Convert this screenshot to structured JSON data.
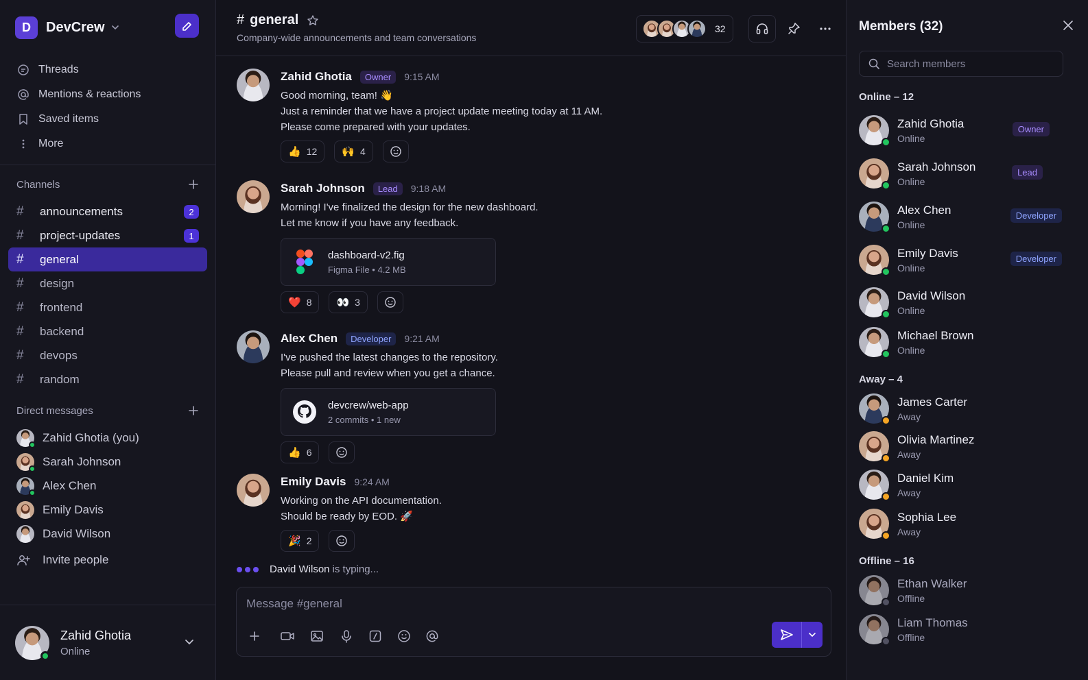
{
  "workspace": {
    "name": "DevCrew",
    "logo_letter": "D"
  },
  "nav": [
    {
      "label": "Threads",
      "icon": "threads-icon"
    },
    {
      "label": "Mentions & reactions",
      "icon": "at-icon"
    },
    {
      "label": "Saved items",
      "icon": "bookmark-icon"
    },
    {
      "label": "More",
      "icon": "more-vertical-icon"
    }
  ],
  "channels_section": {
    "title": "Channels"
  },
  "channels": [
    {
      "name": "announcements",
      "badge": "2"
    },
    {
      "name": "project-updates",
      "badge": "1"
    },
    {
      "name": "general",
      "badge": ""
    },
    {
      "name": "design",
      "badge": ""
    },
    {
      "name": "frontend",
      "badge": ""
    },
    {
      "name": "backend",
      "badge": ""
    },
    {
      "name": "devops",
      "badge": ""
    },
    {
      "name": "random",
      "badge": ""
    }
  ],
  "dm_section": {
    "title": "Direct messages"
  },
  "direct_messages": [
    {
      "name": "Zahid Ghotia (you)"
    },
    {
      "name": "Sarah Johnson"
    },
    {
      "name": "Alex Chen"
    },
    {
      "name": "Emily Davis"
    },
    {
      "name": "David Wilson"
    }
  ],
  "invite_label": "Invite people",
  "current_user": {
    "name": "Zahid Ghotia",
    "status": "Online"
  },
  "channel": {
    "hash": "#",
    "name": "general",
    "description": "Company-wide announcements and team conversations",
    "member_count": "32"
  },
  "messages": [
    {
      "author": "Zahid Ghotia",
      "role": "Owner",
      "time": "9:15 AM",
      "lines": [
        "Good morning, team! 👋",
        "Just a reminder that we have a project update meeting today at 11 AM.",
        "Please come prepared with your updates."
      ],
      "reactions": [
        {
          "emoji": "👍",
          "count": "12"
        },
        {
          "emoji": "🙌",
          "count": "4"
        }
      ]
    },
    {
      "author": "Sarah Johnson",
      "role": "Lead",
      "time": "9:18 AM",
      "lines": [
        "Morning! I've finalized the design for the new dashboard.",
        "Let me know if you have any feedback."
      ],
      "attachment": {
        "name": "dashboard-v2.fig",
        "type": "Figma File",
        "size": "4.2 MB"
      },
      "reactions": [
        {
          "emoji": "❤️",
          "count": "8"
        },
        {
          "emoji": "👀",
          "count": "3"
        }
      ]
    },
    {
      "author": "Alex Chen",
      "role": "Developer",
      "time": "9:21 AM",
      "lines": [
        "I've pushed the latest changes to the repository.",
        "Please pull and review when you get a chance."
      ],
      "attachment": {
        "name": "devcrew/web-app",
        "type": "2 commits",
        "size": "1 new"
      },
      "reactions": [
        {
          "emoji": "👍",
          "count": "6"
        }
      ]
    },
    {
      "author": "Emily Davis",
      "role": "",
      "time": "9:24 AM",
      "lines": [
        "Working on the API documentation.",
        "Should be ready by EOD. 🚀"
      ],
      "reactions": [
        {
          "emoji": "🎉",
          "count": "2"
        }
      ]
    }
  ],
  "typing": {
    "who": "David Wilson",
    "text": "is typing..."
  },
  "composer": {
    "placeholder": "Message #general"
  },
  "members_panel": {
    "title": "Members (32)",
    "search_placeholder": "Search members",
    "groups": [
      {
        "label": "Online – 12",
        "members": [
          {
            "name": "Zahid Ghotia",
            "status": "Online",
            "role": "Owner"
          },
          {
            "name": "Sarah Johnson",
            "status": "Online",
            "role": "Lead"
          },
          {
            "name": "Alex Chen",
            "status": "Online",
            "role": "Developer"
          },
          {
            "name": "Emily Davis",
            "status": "Online",
            "role": "Developer"
          },
          {
            "name": "David Wilson",
            "status": "Online",
            "role": ""
          },
          {
            "name": "Michael Brown",
            "status": "Online",
            "role": ""
          }
        ]
      },
      {
        "label": "Away – 4",
        "members": [
          {
            "name": "James Carter",
            "status": "Away",
            "role": ""
          },
          {
            "name": "Olivia Martinez",
            "status": "Away",
            "role": ""
          },
          {
            "name": "Daniel Kim",
            "status": "Away",
            "role": ""
          },
          {
            "name": "Sophia Lee",
            "status": "Away",
            "role": ""
          }
        ]
      },
      {
        "label": "Offline – 16",
        "members": [
          {
            "name": "Ethan Walker",
            "status": "Offline",
            "role": ""
          },
          {
            "name": "Liam Thomas",
            "status": "Offline",
            "role": ""
          }
        ]
      }
    ]
  },
  "colors": {
    "accent": "#4b2fc9",
    "online": "#22c55e",
    "away": "#f5a524",
    "offline": "#6b6b7e"
  }
}
